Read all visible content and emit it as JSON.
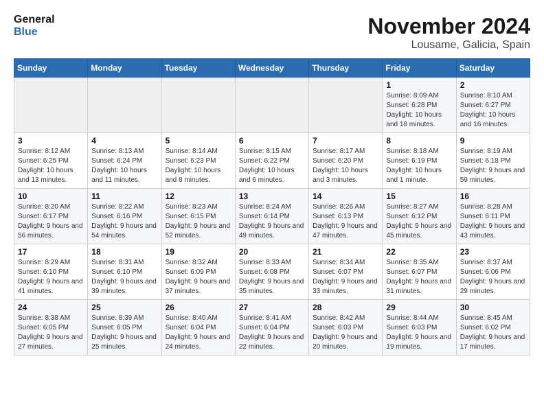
{
  "header": {
    "logo_line1": "General",
    "logo_line2": "Blue",
    "month_title": "November 2024",
    "location": "Lousame, Galicia, Spain"
  },
  "weekdays": [
    "Sunday",
    "Monday",
    "Tuesday",
    "Wednesday",
    "Thursday",
    "Friday",
    "Saturday"
  ],
  "weeks": [
    [
      {
        "day": "",
        "info": ""
      },
      {
        "day": "",
        "info": ""
      },
      {
        "day": "",
        "info": ""
      },
      {
        "day": "",
        "info": ""
      },
      {
        "day": "",
        "info": ""
      },
      {
        "day": "1",
        "info": "Sunrise: 8:09 AM\nSunset: 6:28 PM\nDaylight: 10 hours and 18 minutes."
      },
      {
        "day": "2",
        "info": "Sunrise: 8:10 AM\nSunset: 6:27 PM\nDaylight: 10 hours and 16 minutes."
      }
    ],
    [
      {
        "day": "3",
        "info": "Sunrise: 8:12 AM\nSunset: 6:25 PM\nDaylight: 10 hours and 13 minutes."
      },
      {
        "day": "4",
        "info": "Sunrise: 8:13 AM\nSunset: 6:24 PM\nDaylight: 10 hours and 11 minutes."
      },
      {
        "day": "5",
        "info": "Sunrise: 8:14 AM\nSunset: 6:23 PM\nDaylight: 10 hours and 8 minutes."
      },
      {
        "day": "6",
        "info": "Sunrise: 8:15 AM\nSunset: 6:22 PM\nDaylight: 10 hours and 6 minutes."
      },
      {
        "day": "7",
        "info": "Sunrise: 8:17 AM\nSunset: 6:20 PM\nDaylight: 10 hours and 3 minutes."
      },
      {
        "day": "8",
        "info": "Sunrise: 8:18 AM\nSunset: 6:19 PM\nDaylight: 10 hours and 1 minute."
      },
      {
        "day": "9",
        "info": "Sunrise: 8:19 AM\nSunset: 6:18 PM\nDaylight: 9 hours and 59 minutes."
      }
    ],
    [
      {
        "day": "10",
        "info": "Sunrise: 8:20 AM\nSunset: 6:17 PM\nDaylight: 9 hours and 56 minutes."
      },
      {
        "day": "11",
        "info": "Sunrise: 8:22 AM\nSunset: 6:16 PM\nDaylight: 9 hours and 54 minutes."
      },
      {
        "day": "12",
        "info": "Sunrise: 8:23 AM\nSunset: 6:15 PM\nDaylight: 9 hours and 52 minutes."
      },
      {
        "day": "13",
        "info": "Sunrise: 8:24 AM\nSunset: 6:14 PM\nDaylight: 9 hours and 49 minutes."
      },
      {
        "day": "14",
        "info": "Sunrise: 8:26 AM\nSunset: 6:13 PM\nDaylight: 9 hours and 47 minutes."
      },
      {
        "day": "15",
        "info": "Sunrise: 8:27 AM\nSunset: 6:12 PM\nDaylight: 9 hours and 45 minutes."
      },
      {
        "day": "16",
        "info": "Sunrise: 8:28 AM\nSunset: 6:11 PM\nDaylight: 9 hours and 43 minutes."
      }
    ],
    [
      {
        "day": "17",
        "info": "Sunrise: 8:29 AM\nSunset: 6:10 PM\nDaylight: 9 hours and 41 minutes."
      },
      {
        "day": "18",
        "info": "Sunrise: 8:31 AM\nSunset: 6:10 PM\nDaylight: 9 hours and 39 minutes."
      },
      {
        "day": "19",
        "info": "Sunrise: 8:32 AM\nSunset: 6:09 PM\nDaylight: 9 hours and 37 minutes."
      },
      {
        "day": "20",
        "info": "Sunrise: 8:33 AM\nSunset: 6:08 PM\nDaylight: 9 hours and 35 minutes."
      },
      {
        "day": "21",
        "info": "Sunrise: 8:34 AM\nSunset: 6:07 PM\nDaylight: 9 hours and 33 minutes."
      },
      {
        "day": "22",
        "info": "Sunrise: 8:35 AM\nSunset: 6:07 PM\nDaylight: 9 hours and 31 minutes."
      },
      {
        "day": "23",
        "info": "Sunrise: 8:37 AM\nSunset: 6:06 PM\nDaylight: 9 hours and 29 minutes."
      }
    ],
    [
      {
        "day": "24",
        "info": "Sunrise: 8:38 AM\nSunset: 6:05 PM\nDaylight: 9 hours and 27 minutes."
      },
      {
        "day": "25",
        "info": "Sunrise: 8:39 AM\nSunset: 6:05 PM\nDaylight: 9 hours and 25 minutes."
      },
      {
        "day": "26",
        "info": "Sunrise: 8:40 AM\nSunset: 6:04 PM\nDaylight: 9 hours and 24 minutes."
      },
      {
        "day": "27",
        "info": "Sunrise: 8:41 AM\nSunset: 6:04 PM\nDaylight: 9 hours and 22 minutes."
      },
      {
        "day": "28",
        "info": "Sunrise: 8:42 AM\nSunset: 6:03 PM\nDaylight: 9 hours and 20 minutes."
      },
      {
        "day": "29",
        "info": "Sunrise: 8:44 AM\nSunset: 6:03 PM\nDaylight: 9 hours and 19 minutes."
      },
      {
        "day": "30",
        "info": "Sunrise: 8:45 AM\nSunset: 6:02 PM\nDaylight: 9 hours and 17 minutes."
      }
    ]
  ]
}
